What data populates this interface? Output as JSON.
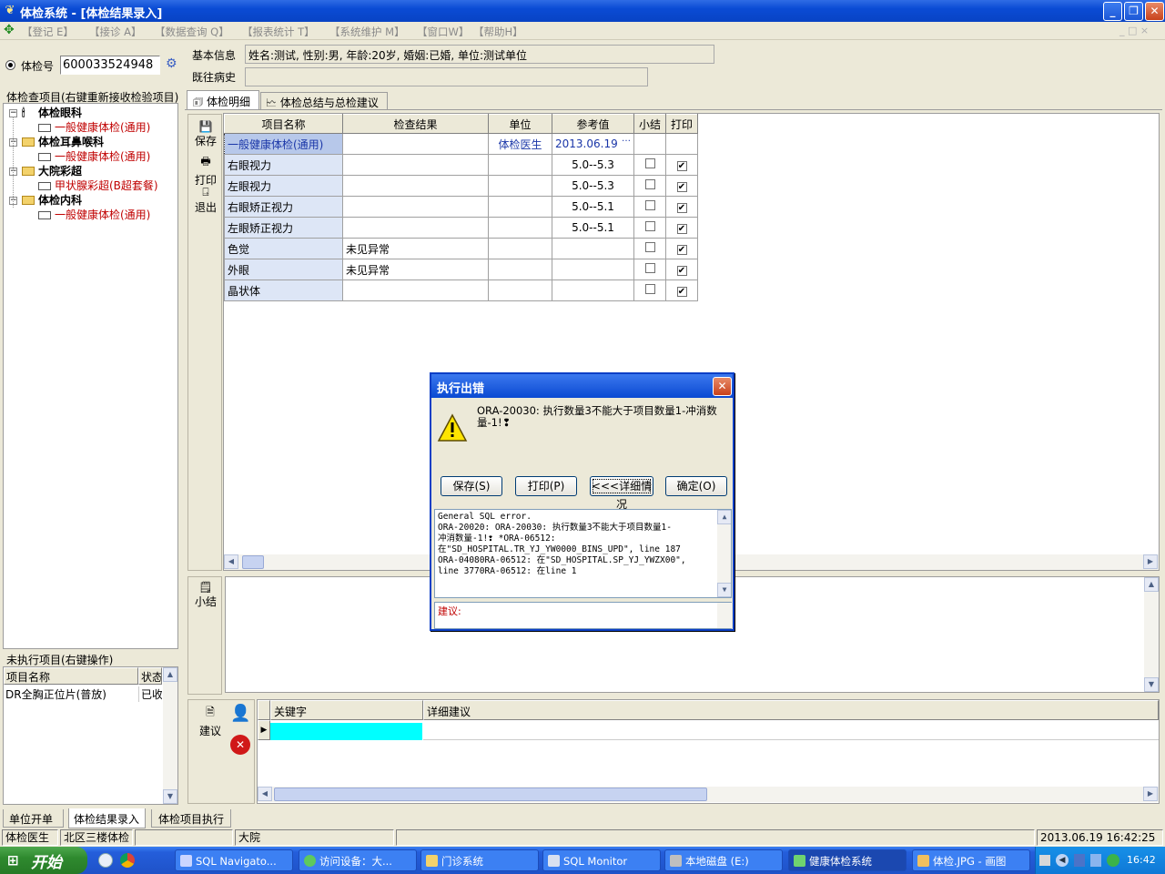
{
  "window": {
    "title": "体检系统 - [体检结果录入]"
  },
  "menu": {
    "items": [
      "【登记 E】",
      "【接诊 A】",
      "【数据查询 Q】",
      "【报表统计 T】",
      "【系统维护 M】",
      "【窗口W】",
      "【帮助H】"
    ],
    "mdi_controls": "_ □ ×"
  },
  "exam": {
    "number_label": "体检号",
    "number_value": "600033524948",
    "basic_info_label": "基本信息",
    "basic_info_value": "姓名:测试, 性别:男, 年龄:20岁, 婚姻:已婚, 单位:测试单位",
    "history_label": "既往病史",
    "history_value": ""
  },
  "tree": {
    "header": "体检查项目(右键重新接收检验项目)",
    "nodes": [
      {
        "label": "体检眼科",
        "child": "一般健康体检(通用)"
      },
      {
        "label": "体检耳鼻喉科",
        "child": "一般健康体检(通用)"
      },
      {
        "label": "大院彩超",
        "child": "甲状腺彩超(B超套餐)"
      },
      {
        "label": "体检内科",
        "child": "一般健康体检(通用)"
      }
    ]
  },
  "pending": {
    "header": "未执行项目(右键操作)",
    "col_name": "项目名称",
    "col_status": "状态",
    "rows": [
      {
        "name": "DR全胸正位片(普放)",
        "status": "已收"
      }
    ]
  },
  "tabs": {
    "detail": "体检明细",
    "summary": "体检总结与总检建议"
  },
  "side_toolbar": {
    "save": "保存",
    "print": "打印",
    "exit": "退出",
    "subtotal": "小结",
    "advice": "建议"
  },
  "grid": {
    "columns": [
      "项目名称",
      "检查结果",
      "单位",
      "参考值",
      "小结",
      "打印"
    ],
    "rows": [
      {
        "name": "一般健康体检(通用)",
        "result": "",
        "unit": "体检医生",
        "ref": "2013.06.19",
        "summary": false,
        "print": false,
        "ellipsis": "…"
      },
      {
        "name": "右眼视力",
        "result": "",
        "unit": "",
        "ref": "5.0--5.3",
        "summary": false,
        "print": true
      },
      {
        "name": "左眼视力",
        "result": "",
        "unit": "",
        "ref": "5.0--5.3",
        "summary": false,
        "print": true
      },
      {
        "name": "右眼矫正视力",
        "result": "",
        "unit": "",
        "ref": "5.0--5.1",
        "summary": false,
        "print": true
      },
      {
        "name": "左眼矫正视力",
        "result": "",
        "unit": "",
        "ref": "5.0--5.1",
        "summary": false,
        "print": true
      },
      {
        "name": "色觉",
        "result": "未见异常",
        "unit": "",
        "ref": "",
        "summary": false,
        "print": true
      },
      {
        "name": "外眼",
        "result": "未见异常",
        "unit": "",
        "ref": "",
        "summary": false,
        "print": true
      },
      {
        "name": "晶状体",
        "result": "",
        "unit": "",
        "ref": "",
        "summary": false,
        "print": true
      }
    ]
  },
  "advice_grid": {
    "col_keyword": "关键字",
    "col_detail": "详细建议"
  },
  "dialog": {
    "title": "执行出错",
    "message": "ORA-20030: 执行数量3不能大于项目数量1-冲消数量-1!❢",
    "buttons": {
      "save": "保存(S)",
      "print": "打印(P)",
      "details": "<<<详细情况",
      "ok": "确定(O)"
    },
    "detail_lines": [
      "General SQL error.",
      "ORA-20020: ORA-20030: 执行数量3不能大于项目数量1-",
      "冲消数量-1!❢ *ORA-06512:",
      "在\"SD_HOSPITAL.TR_YJ_YW0000_BINS_UPD\", line 187",
      "ORA-04080RA-06512: 在\"SD_HOSPITAL.SP_YJ_YWZX00\",",
      "line 3770RA-06512: 在line 1"
    ],
    "advice_label": "建议:"
  },
  "bottom_tabs": [
    "单位开单",
    "体检结果录入",
    "体检项目执行"
  ],
  "status": {
    "user": "体检医生",
    "location": "北区三楼体检",
    "blank": "",
    "hospital": "大院",
    "datetime": "2013.06.19 16:42:25"
  },
  "taskbar": {
    "start": "开始",
    "tasks": [
      "SQL Navigato...",
      "访问设备：大...",
      "门诊系统",
      "SQL Monitor",
      "本地磁盘 (E:)",
      "健康体检系统",
      "体检.JPG - 画图"
    ],
    "clock": "16:42"
  }
}
